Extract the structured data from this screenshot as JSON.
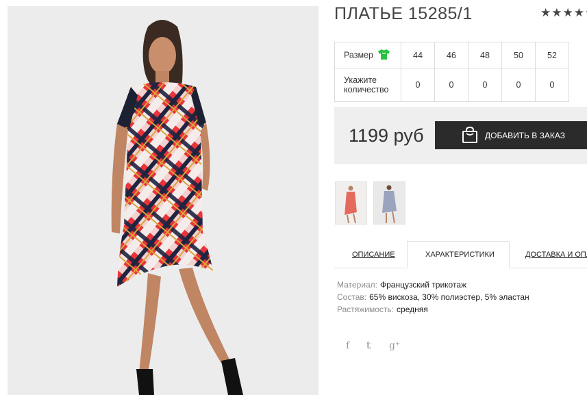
{
  "product": {
    "title": "ПЛАТЬЕ 15285/1",
    "rating_stars": "★★★★★"
  },
  "sizes": {
    "size_label": "Размер",
    "qty_label": "Укажите количество",
    "values": [
      "44",
      "46",
      "48",
      "50",
      "52"
    ],
    "quantities": [
      "0",
      "0",
      "0",
      "0",
      "0"
    ]
  },
  "buy": {
    "price": "1199 руб",
    "button_label": "ДОБАВИТЬ В ЗАКАЗ"
  },
  "tabs": {
    "description": "ОПИСАНИЕ",
    "characteristics": "ХАРАКТЕРИСТИКИ",
    "delivery": "ДОСТАВКА И ОПЛАТА"
  },
  "specs": [
    {
      "key": "Материал:",
      "value": "Французский трикотаж"
    },
    {
      "key": "Состав:",
      "value": "65% вискоза, 30% полиэстер, 5% эластан"
    },
    {
      "key": "Растяжимость:",
      "value": "средняя"
    }
  ],
  "social": {
    "facebook": "f",
    "twitter": "𝕥",
    "googleplus": "g⁺"
  },
  "colors": {
    "accent_icon": "#27c23f",
    "button_bg": "#2b2b2b",
    "price_bg": "#efefef"
  },
  "icons": [
    "shirt-icon",
    "shopping-bag-icon",
    "facebook-icon",
    "twitter-icon",
    "google-plus-icon"
  ]
}
